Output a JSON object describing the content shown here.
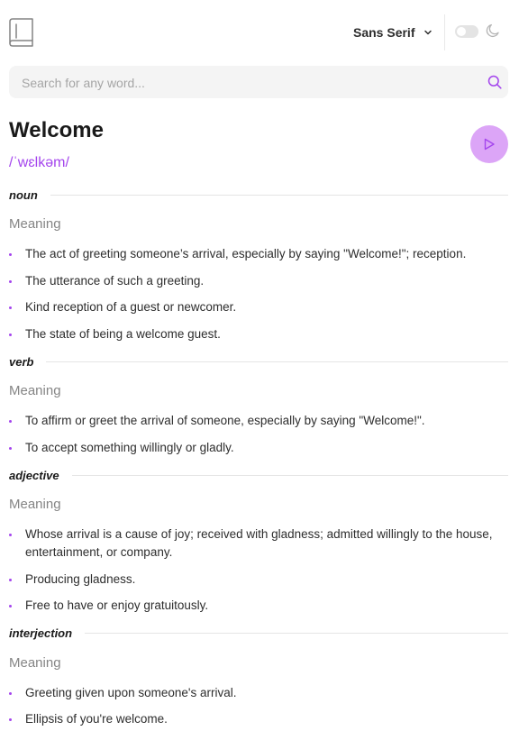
{
  "header": {
    "font_label": "Sans Serif"
  },
  "search": {
    "placeholder": "Search for any word..."
  },
  "entry": {
    "word": "Welcome",
    "phonetic": "/ˈwɛlkəm/"
  },
  "meanings": [
    {
      "part_of_speech": "noun",
      "meaning_label": "Meaning",
      "definitions": [
        "The act of greeting someone’s arrival, especially by saying \"Welcome!\"; reception.",
        "The utterance of such a greeting.",
        "Kind reception of a guest or newcomer.",
        "The state of being a welcome guest."
      ]
    },
    {
      "part_of_speech": "verb",
      "meaning_label": "Meaning",
      "definitions": [
        "To affirm or greet the arrival of someone, especially by saying \"Welcome!\".",
        "To accept something willingly or gladly."
      ]
    },
    {
      "part_of_speech": "adjective",
      "meaning_label": "Meaning",
      "definitions": [
        "Whose arrival is a cause of joy; received with gladness; admitted willingly to the house, entertainment, or company.",
        "Producing gladness.",
        "Free to have or enjoy gratuitously."
      ]
    },
    {
      "part_of_speech": "interjection",
      "meaning_label": "Meaning",
      "definitions": [
        "Greeting given upon someone's arrival.",
        "Ellipsis of you're welcome."
      ]
    }
  ],
  "colors": {
    "accent": "#a445ed",
    "play_bg": "#dca5f7",
    "meaning_label": "#858585"
  },
  "icons": {
    "logo": "book-icon",
    "font_dropdown": "chevron-down-icon",
    "theme": "moon-icon",
    "search": "search-icon",
    "play": "play-icon"
  }
}
